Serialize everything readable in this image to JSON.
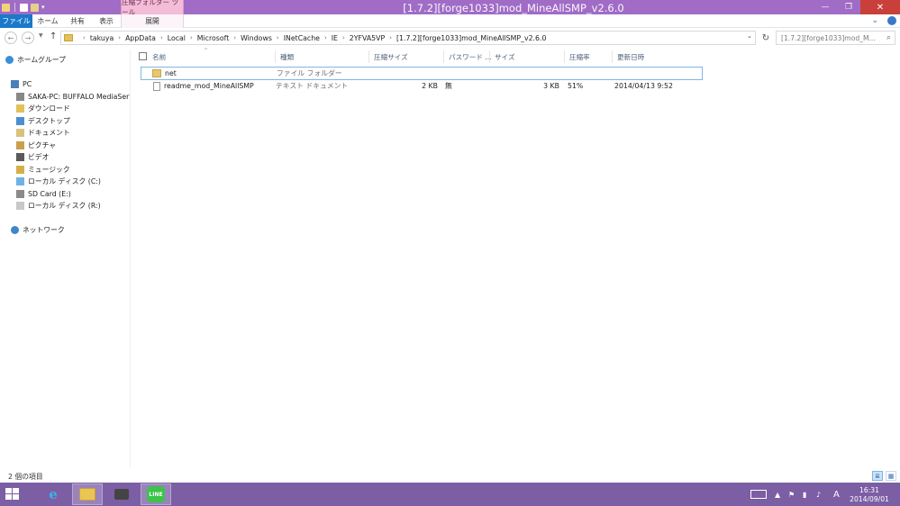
{
  "window": {
    "title": "[1.7.2][forge1033]mod_MineAllSMP_v2.6.0",
    "context_tab_group": "圧縮フォルダー ツール",
    "btn_min": "—",
    "btn_max": "❐",
    "btn_close": "✕"
  },
  "ribbon": {
    "tabs": [
      "ファイル",
      "ホーム",
      "共有",
      "表示",
      "展開"
    ]
  },
  "address": {
    "crumbs": [
      "takuya",
      "AppData",
      "Local",
      "Microsoft",
      "Windows",
      "INetCache",
      "IE",
      "2YFVA5VP",
      "[1.7.2][forge1033]mod_MineAllSMP_v2.6.0"
    ],
    "search_placeholder": "[1.7.2][forge1033]mod_M..."
  },
  "sidebar": {
    "items": [
      {
        "label": "ホームグループ",
        "icon": "homegroup-icon"
      },
      {
        "label": "PC",
        "icon": "pc-icon"
      },
      {
        "label": "SAKA-PC: BUFFALO MediaServer",
        "icon": "media-server-icon"
      },
      {
        "label": "ダウンロード",
        "icon": "downloads-icon"
      },
      {
        "label": "デスクトップ",
        "icon": "desktop-icon"
      },
      {
        "label": "ドキュメント",
        "icon": "documents-icon"
      },
      {
        "label": "ピクチャ",
        "icon": "pictures-icon"
      },
      {
        "label": "ビデオ",
        "icon": "videos-icon"
      },
      {
        "label": "ミュージック",
        "icon": "music-icon"
      },
      {
        "label": "ローカル ディスク (C:)",
        "icon": "local-disk-icon"
      },
      {
        "label": "SD Card (E:)",
        "icon": "sd-card-icon"
      },
      {
        "label": "ローカル ディスク (R:)",
        "icon": "drive-icon"
      },
      {
        "label": "ネットワーク",
        "icon": "network-icon"
      }
    ]
  },
  "columns": {
    "name": "名前",
    "type": "種類",
    "compressed_size": "圧縮サイズ",
    "password": "パスワード ...",
    "size": "サイズ",
    "ratio": "圧縮率",
    "modified": "更新日時"
  },
  "files": [
    {
      "name": "net",
      "type": "ファイル フォルダー",
      "compressed_size": "",
      "password": "",
      "size": "",
      "ratio": "",
      "modified": "",
      "icon": "folder-icon"
    },
    {
      "name": "readme_mod_MineAllSMP",
      "type": "テキスト ドキュメント",
      "compressed_size": "2 KB",
      "password": "無",
      "size": "3 KB",
      "ratio": "51%",
      "modified": "2014/04/13 9:52",
      "icon": "text-document-icon"
    }
  ],
  "status": {
    "item_count": "2 個の項目"
  },
  "taskbar": {
    "line_label": "LINE",
    "ime": "A",
    "time": "16:31",
    "date": "2014/09/01"
  },
  "colors": {
    "titlebar": "#a06cc6",
    "file_tab": "#1979ca",
    "context_tab": "#f3bcd9",
    "taskbar": "#7b5ea3",
    "close": "#c9403a"
  }
}
